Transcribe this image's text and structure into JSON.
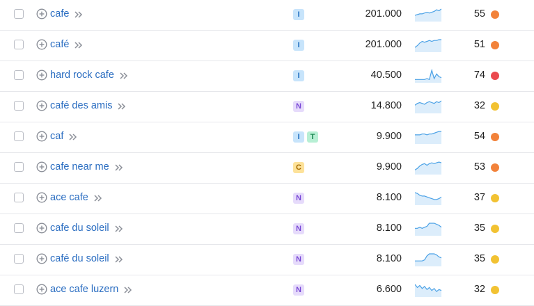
{
  "colors": {
    "link": "#2a6dc1",
    "intent_I": {
      "bg": "#c7e4fb",
      "fg": "#2773c2"
    },
    "intent_T": {
      "bg": "#b7efd4",
      "fg": "#1f8a55"
    },
    "intent_N": {
      "bg": "#e6dbfb",
      "fg": "#7a4ad6"
    },
    "intent_C": {
      "bg": "#fde29a",
      "fg": "#a46a00"
    },
    "kd_orange": "#f2823a",
    "kd_red": "#eb4a4f",
    "kd_yellow": "#f2c232",
    "trend_line": "#4aa1e6",
    "trend_fill": "#dcedfb"
  },
  "rows": [
    {
      "keyword": "cafe",
      "intents": [
        "I"
      ],
      "volume": "201.000",
      "kd": "55",
      "kd_level": "orange",
      "trend": [
        6,
        7,
        8,
        8,
        9,
        10,
        9,
        10,
        11,
        13,
        12,
        14
      ]
    },
    {
      "keyword": "café",
      "intents": [
        "I"
      ],
      "volume": "201.000",
      "kd": "51",
      "kd_level": "orange",
      "trend": [
        4,
        6,
        9,
        11,
        10,
        11,
        12,
        11,
        12,
        12,
        13,
        13
      ]
    },
    {
      "keyword": "hard rock cafe",
      "intents": [
        "I"
      ],
      "volume": "40.500",
      "kd": "74",
      "kd_level": "red",
      "trend": [
        2,
        2,
        2,
        2,
        2,
        3,
        2,
        12,
        3,
        8,
        5,
        4
      ]
    },
    {
      "keyword": "café des amis",
      "intents": [
        "N"
      ],
      "volume": "14.800",
      "kd": "32",
      "kd_level": "yellow",
      "trend": [
        8,
        10,
        11,
        10,
        9,
        11,
        12,
        11,
        10,
        12,
        11,
        13
      ]
    },
    {
      "keyword": "caf",
      "intents": [
        "I",
        "T"
      ],
      "volume": "9.900",
      "kd": "54",
      "kd_level": "orange",
      "trend": [
        9,
        9,
        9,
        10,
        10,
        9,
        10,
        10,
        11,
        12,
        13,
        13
      ]
    },
    {
      "keyword": "cafe near me",
      "intents": [
        "C"
      ],
      "volume": "9.900",
      "kd": "53",
      "kd_level": "orange",
      "trend": [
        4,
        6,
        9,
        11,
        12,
        10,
        12,
        13,
        12,
        13,
        14,
        13
      ]
    },
    {
      "keyword": "ace cafe",
      "intents": [
        "N"
      ],
      "volume": "8.100",
      "kd": "37",
      "kd_level": "yellow",
      "trend": [
        13,
        12,
        10,
        9,
        9,
        8,
        7,
        6,
        5,
        5,
        6,
        8
      ]
    },
    {
      "keyword": "cafe du soleil",
      "intents": [
        "N"
      ],
      "volume": "8.100",
      "kd": "35",
      "kd_level": "yellow",
      "trend": [
        6,
        6,
        7,
        6,
        7,
        8,
        11,
        11,
        11,
        10,
        9,
        7
      ]
    },
    {
      "keyword": "café du soleil",
      "intents": [
        "N"
      ],
      "volume": "8.100",
      "kd": "35",
      "kd_level": "yellow",
      "trend": [
        4,
        4,
        4,
        4,
        5,
        9,
        11,
        11,
        11,
        10,
        8,
        7
      ]
    },
    {
      "keyword": "ace cafe luzern",
      "intents": [
        "N"
      ],
      "volume": "6.600",
      "kd": "32",
      "kd_level": "yellow",
      "trend": [
        11,
        8,
        10,
        7,
        9,
        6,
        8,
        5,
        7,
        4,
        6,
        5
      ]
    }
  ]
}
